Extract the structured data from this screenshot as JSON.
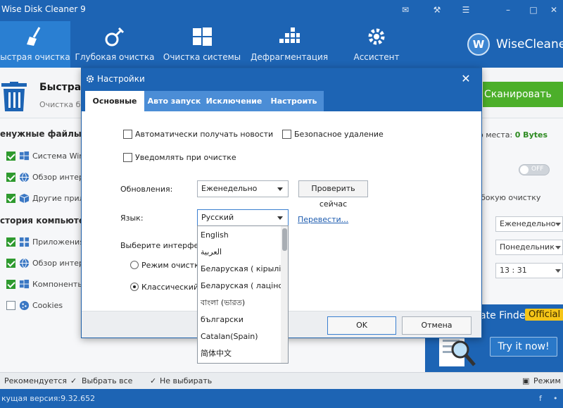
{
  "app": {
    "title": "Wise Disk Cleaner 9"
  },
  "nav": {
    "tabs": [
      {
        "label": "ыстрая очистка",
        "icon": "broom-icon"
      },
      {
        "label": "Глубокая очистка",
        "icon": "deep-clean-icon"
      },
      {
        "label": "Очистка системы",
        "icon": "windows-icon"
      },
      {
        "label": "Дефрагментация",
        "icon": "defrag-icon"
      },
      {
        "label": "Ассистент",
        "icon": "gear-wrench-icon"
      }
    ],
    "brand": "WiseCleaner",
    "brand_letter": "W"
  },
  "hero": {
    "title": "Быстрая",
    "subtitle": "Очистка бе",
    "scan_label": "Сканировать"
  },
  "left": {
    "section1": "енужные файлы",
    "items1": [
      {
        "label": "Система Wind",
        "checked": true
      },
      {
        "label": "Обзор интерн",
        "checked": true
      },
      {
        "label": "Другие прило",
        "checked": true
      }
    ],
    "section2": "стория компьютера",
    "items2": [
      {
        "label": "Приложения",
        "checked": true
      },
      {
        "label": "Обзор интерн",
        "checked": true
      },
      {
        "label": "Компоненты W",
        "checked": true
      },
      {
        "label": "Cookies",
        "checked": false
      }
    ]
  },
  "right": {
    "space_label": "о места:",
    "space_value": "0 Bytes",
    "toggle_label": "OFF",
    "hint": "бокую очистку",
    "freq": "Еженедельно",
    "day": "Понедельник",
    "time": "13 : 31"
  },
  "promo": {
    "title": "ate Finder",
    "badge": "Official",
    "try_label": "Try it now!"
  },
  "bottom": {
    "recommended": "Рекомендуется",
    "select_all": "Выбрать все",
    "select_none": "Не выбирать",
    "mode": "Режим о"
  },
  "status": {
    "version": "кущая версия:9.32.652",
    "facebook": "f",
    "more": "•"
  },
  "dialog": {
    "title": "Настройки",
    "close": "✕",
    "tabs": [
      "Основные",
      "Авто запуск",
      "Исключение",
      "Настроить"
    ],
    "options": {
      "news": "Автоматически получать новости",
      "secure_delete": "Безопасное удаление",
      "notify": "Уведомлять при очистке"
    },
    "updates_label": "Обновления:",
    "updates_value": "Еженедельно",
    "check_now": "Проверить сейчас",
    "language_label": "Язык:",
    "language_value": "Русский",
    "translate_link": "Перевести...",
    "interface_label": "Выберите интерфейс",
    "radio1": "Режим очистки",
    "radio2": "Классический ви",
    "ok": "OK",
    "cancel": "Отмена"
  },
  "languages": [
    "English",
    "العربية",
    "Беларуская ( кірылі...",
    "Беларуская ( лацінс...",
    "বাংলা (ভারত)",
    "български",
    "Catalan(Spain)",
    "简体中文"
  ]
}
